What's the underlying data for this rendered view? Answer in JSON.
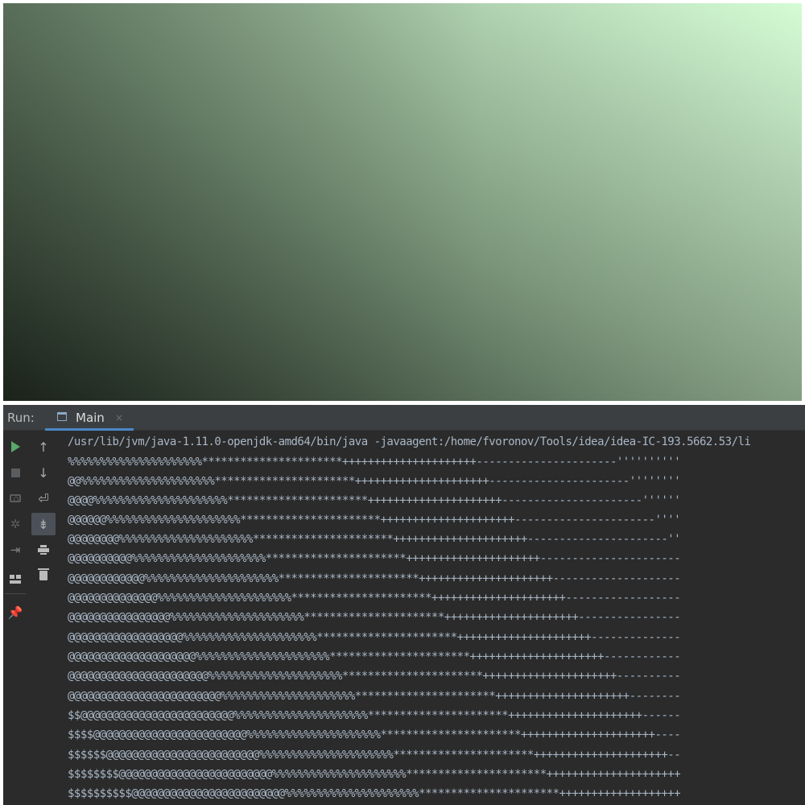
{
  "canvas": {
    "gradient_colors": [
      "#1e261e",
      "#4a5b4a",
      "#7a957a",
      "#a6c6a6",
      "#d3fcd3"
    ]
  },
  "run_panel": {
    "title": "Run:",
    "tab": {
      "icon": "window-icon",
      "label": "Main",
      "close_label": "×"
    },
    "toolbar_left": [
      {
        "name": "rerun-button",
        "icon": "play-icon"
      },
      {
        "name": "stop-button",
        "icon": "stop-icon"
      },
      {
        "name": "dump-threads-button",
        "icon": "camera-icon"
      },
      {
        "name": "debug-button",
        "icon": "bug-icon"
      },
      {
        "name": "exit-button",
        "icon": "exit-icon"
      },
      {
        "name": "restore-layout-button",
        "icon": "layout-icon"
      },
      {
        "name": "pin-tab-button",
        "icon": "pin-icon"
      }
    ],
    "toolbar_right": [
      {
        "name": "scroll-up-button",
        "icon": "arrow-up-icon",
        "glyph": "↑"
      },
      {
        "name": "scroll-down-button",
        "icon": "arrow-down-icon",
        "glyph": "↓"
      },
      {
        "name": "soft-wrap-button",
        "icon": "soft-wrap-icon",
        "glyph": "⏎"
      },
      {
        "name": "scroll-to-end-button",
        "icon": "scroll-end-icon",
        "glyph": "⇟"
      },
      {
        "name": "print-button",
        "icon": "print-icon"
      },
      {
        "name": "clear-all-button",
        "icon": "trash-icon"
      }
    ],
    "console": {
      "command": "/usr/lib/jvm/java-1.11.0-openjdk-amd64/bin/java -javaagent:/home/fvoronov/Tools/idea/idea-IC-193.5662.53/li",
      "lines": [
        "%%%%%%%%%%%%%%%%%%%%%**********************+++++++++++++++++++++----------------------''''''''''",
        "@@%%%%%%%%%%%%%%%%%%%%%**********************+++++++++++++++++++++----------------------''''''''",
        "@@@@%%%%%%%%%%%%%%%%%%%%%**********************+++++++++++++++++++++----------------------''''''",
        "@@@@@@%%%%%%%%%%%%%%%%%%%%%**********************+++++++++++++++++++++----------------------''''",
        "@@@@@@@@%%%%%%%%%%%%%%%%%%%%%**********************+++++++++++++++++++++----------------------''",
        "@@@@@@@@@@%%%%%%%%%%%%%%%%%%%%%**********************+++++++++++++++++++++----------------------",
        "@@@@@@@@@@@@%%%%%%%%%%%%%%%%%%%%%**********************+++++++++++++++++++++--------------------",
        "@@@@@@@@@@@@@@%%%%%%%%%%%%%%%%%%%%%**********************+++++++++++++++++++++------------------",
        "@@@@@@@@@@@@@@@@%%%%%%%%%%%%%%%%%%%%%**********************+++++++++++++++++++++----------------",
        "@@@@@@@@@@@@@@@@@@%%%%%%%%%%%%%%%%%%%%%**********************+++++++++++++++++++++--------------",
        "@@@@@@@@@@@@@@@@@@@@%%%%%%%%%%%%%%%%%%%%%**********************+++++++++++++++++++++------------",
        "@@@@@@@@@@@@@@@@@@@@@@%%%%%%%%%%%%%%%%%%%%%**********************+++++++++++++++++++++----------",
        "@@@@@@@@@@@@@@@@@@@@@@@@%%%%%%%%%%%%%%%%%%%%%**********************+++++++++++++++++++++--------",
        "$$@@@@@@@@@@@@@@@@@@@@@@@@%%%%%%%%%%%%%%%%%%%%%**********************+++++++++++++++++++++------",
        "$$$$@@@@@@@@@@@@@@@@@@@@@@@@%%%%%%%%%%%%%%%%%%%%%**********************+++++++++++++++++++++----",
        "$$$$$$@@@@@@@@@@@@@@@@@@@@@@@@%%%%%%%%%%%%%%%%%%%%%**********************+++++++++++++++++++++--",
        "$$$$$$$$@@@@@@@@@@@@@@@@@@@@@@@@%%%%%%%%%%%%%%%%%%%%%**********************+++++++++++++++++++++",
        "$$$$$$$$$$@@@@@@@@@@@@@@@@@@@@@@@@%%%%%%%%%%%%%%%%%%%%%**********************+++++++++++++++++++"
      ]
    }
  }
}
